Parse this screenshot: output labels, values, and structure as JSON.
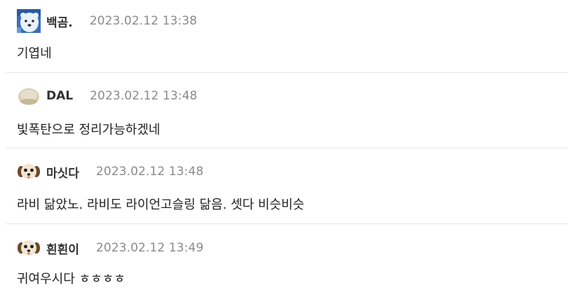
{
  "comments": [
    {
      "username": "백곰.",
      "timestamp": "2023.02.12 13:38",
      "text": "기엽네",
      "avatar": "polar-bear-avatar"
    },
    {
      "username": "DAL",
      "timestamp": "2023.02.12 13:48",
      "text": "빛폭탄으로 정리가능하겠네",
      "avatar": "beige-blob-avatar"
    },
    {
      "username": "마싯다",
      "timestamp": "2023.02.12 13:48",
      "text": "라비 닮았노. 라비도 라이언고슬링 닮음. 셋다 비슷비슷",
      "avatar": "puppy-face-avatar"
    },
    {
      "username": "흰흰이",
      "timestamp": "2023.02.12 13:49",
      "text": "귀여우시다 ㅎㅎㅎㅎ",
      "avatar": "puppy-face-avatar"
    }
  ]
}
